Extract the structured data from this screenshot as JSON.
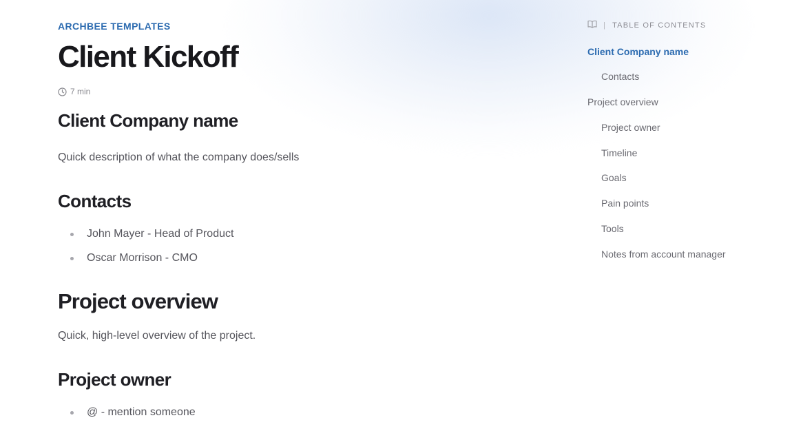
{
  "article": {
    "category": "ARCHBEE TEMPLATES",
    "title": "Client Kickoff",
    "read_time": "7 min",
    "sections": {
      "company": {
        "heading": "Client Company name",
        "text": "Quick description of what the company does/sells"
      },
      "contacts": {
        "heading": "Contacts",
        "items": [
          "John Mayer - Head of Product",
          "Oscar Morrison - CMO"
        ]
      },
      "overview": {
        "heading": "Project overview",
        "text": "Quick, high-level overview of the project."
      },
      "owner": {
        "heading": "Project owner",
        "items": [
          "@ - mention someone"
        ]
      }
    }
  },
  "toc": {
    "label": "TABLE OF CONTENTS",
    "icon": "book-icon",
    "items": [
      {
        "label": "Client Company name",
        "active": true
      },
      {
        "label": "Contacts"
      },
      {
        "label": "Project overview"
      },
      {
        "label": "Project owner"
      },
      {
        "label": "Timeline"
      },
      {
        "label": "Goals"
      },
      {
        "label": "Pain points"
      },
      {
        "label": "Tools"
      },
      {
        "label": "Notes from account manager"
      }
    ]
  },
  "colors": {
    "accent": "#2c6bb0",
    "text": "#1f1f24",
    "muted": "#55555c"
  }
}
